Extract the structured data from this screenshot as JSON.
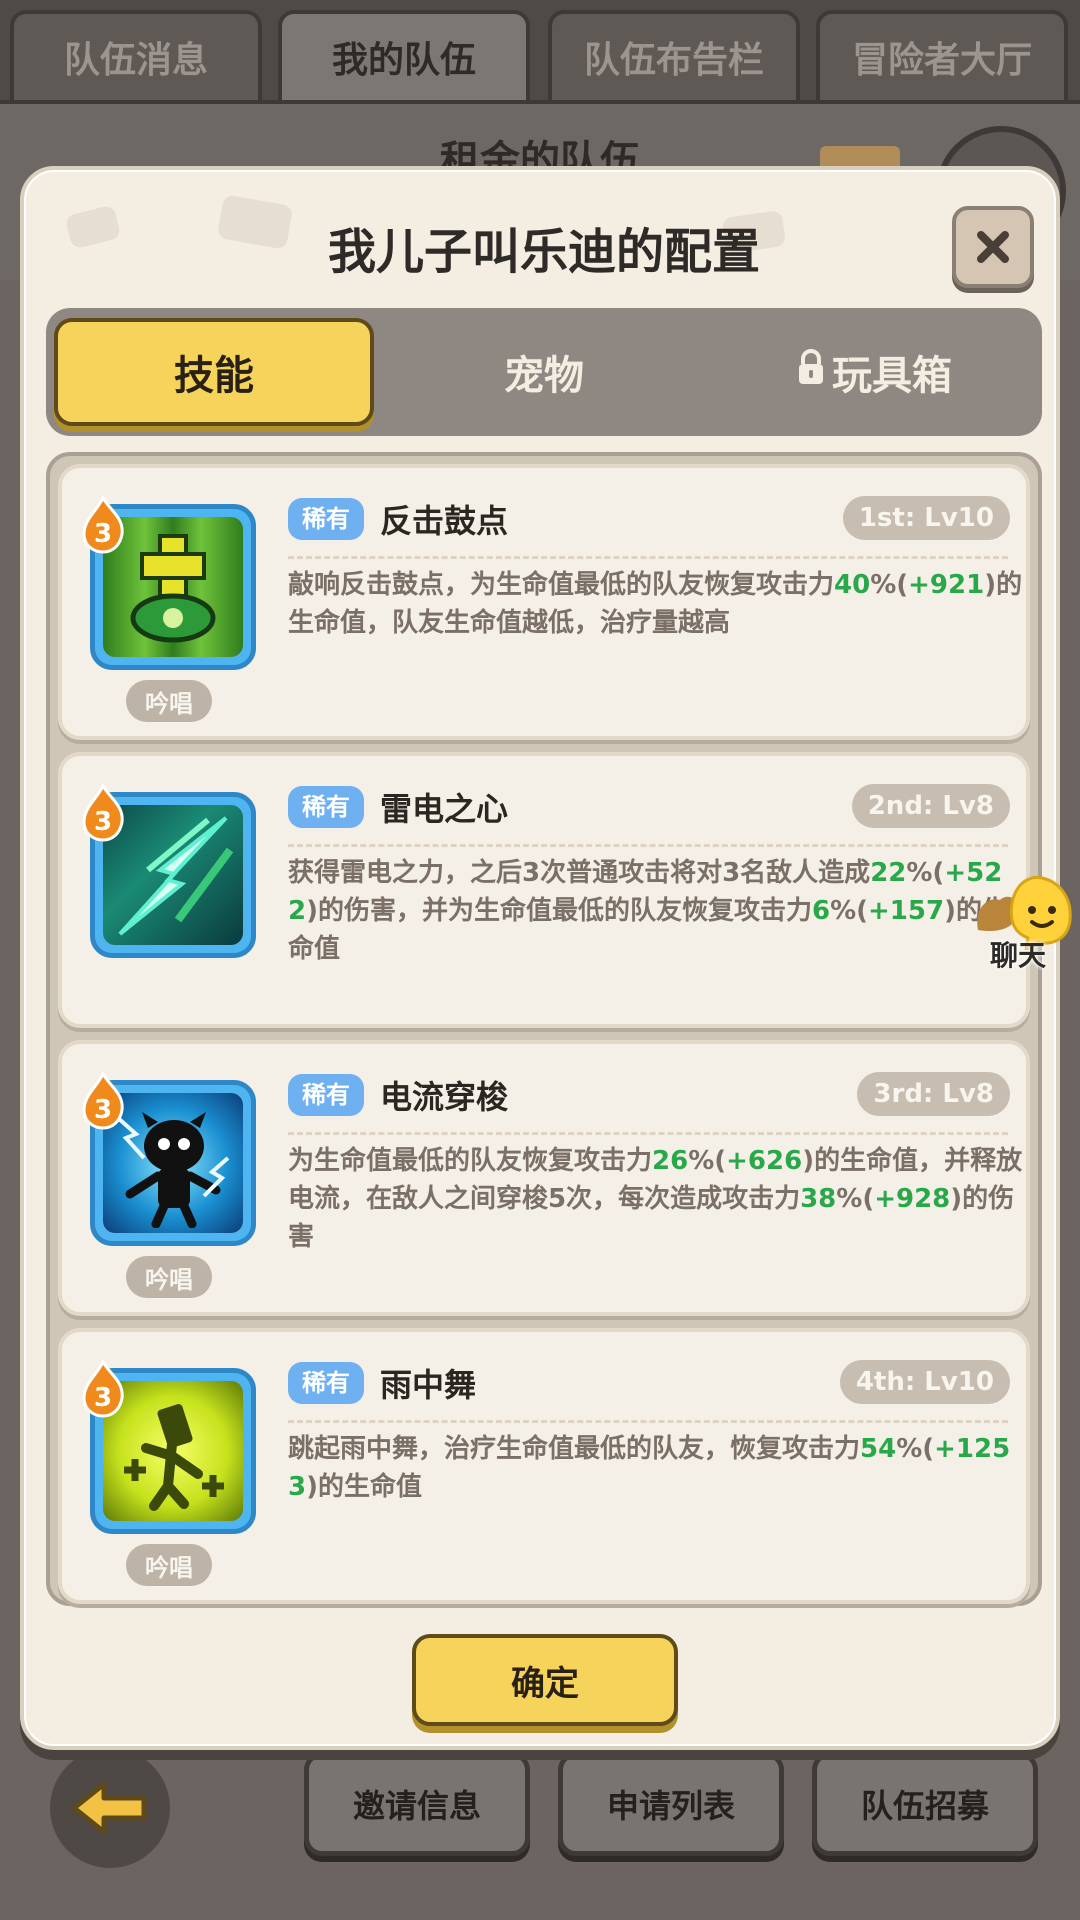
{
  "top_tabs": [
    "队伍消息",
    "我的队伍",
    "队伍布告栏",
    "冒险者大厅"
  ],
  "background_title": "租金的队伍",
  "bottom_buttons": [
    "邀请信息",
    "申请列表",
    "队伍招募"
  ],
  "modal": {
    "title": "我儿子叫乐迪的配置",
    "tabs": [
      "技能",
      "宠物",
      "玩具箱"
    ],
    "confirm_label": "确定"
  },
  "skills": [
    {
      "level": "3",
      "rarity": "稀有",
      "name": "反击鼓点",
      "rank": "1st: Lv10",
      "cast": "吟唱",
      "desc": [
        {
          "t": "敲响反击鼓点，为生命值最低的队友恢复攻击力"
        },
        {
          "t": "40",
          "g": true
        },
        {
          "t": "%("
        },
        {
          "t": "+921",
          "g": true
        },
        {
          "t": ")的生命值，队友生命值越低，治疗量越高"
        }
      ],
      "icon": "drum-heal-icon"
    },
    {
      "level": "3",
      "rarity": "稀有",
      "name": "雷电之心",
      "rank": "2nd: Lv8",
      "cast": "",
      "desc": [
        {
          "t": "获得雷电之力，之后3次普通攻击将对3名敌人造成"
        },
        {
          "t": "22",
          "g": true
        },
        {
          "t": "%("
        },
        {
          "t": "+522",
          "g": true
        },
        {
          "t": ")的伤害，并为生命值最低的队友恢复攻击力"
        },
        {
          "t": "6",
          "g": true
        },
        {
          "t": "%("
        },
        {
          "t": "+157",
          "g": true
        },
        {
          "t": ")的生命值"
        }
      ],
      "icon": "lightning-heart-icon"
    },
    {
      "level": "3",
      "rarity": "稀有",
      "name": "电流穿梭",
      "rank": "3rd: Lv8",
      "cast": "吟唱",
      "desc": [
        {
          "t": "为生命值最低的队友恢复攻击力"
        },
        {
          "t": "26",
          "g": true
        },
        {
          "t": "%("
        },
        {
          "t": "+626",
          "g": true
        },
        {
          "t": ")的生命值，并释放电流，在敌人之间穿梭5次，每次造成攻击力"
        },
        {
          "t": "38",
          "g": true
        },
        {
          "t": "%("
        },
        {
          "t": "+928",
          "g": true
        },
        {
          "t": ")的伤害"
        }
      ],
      "icon": "electric-shuttle-icon"
    },
    {
      "level": "3",
      "rarity": "稀有",
      "name": "雨中舞",
      "rank": "4th: Lv10",
      "cast": "吟唱",
      "desc": [
        {
          "t": "跳起雨中舞，治疗生命值最低的队友，恢复攻击力"
        },
        {
          "t": "54",
          "g": true
        },
        {
          "t": "%("
        },
        {
          "t": "+1253",
          "g": true
        },
        {
          "t": ")的生命值"
        }
      ],
      "icon": "rain-dance-icon"
    }
  ],
  "chat": {
    "label": "聊天"
  },
  "colors": {
    "gold_button": "#f6d45c",
    "rarity_blue": "#6fb0f0",
    "number_green": "#29a84a",
    "panel_cream": "#f3ede2"
  }
}
